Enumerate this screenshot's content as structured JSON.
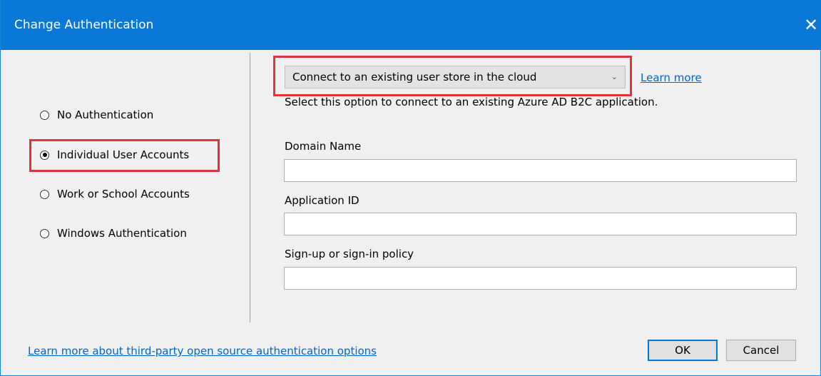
{
  "window": {
    "title": "Change Authentication",
    "close_glyph": "✕"
  },
  "auth_options": {
    "items": [
      {
        "label": "No Authentication",
        "selected": false
      },
      {
        "label": "Individual User Accounts",
        "selected": true
      },
      {
        "label": "Work or School Accounts",
        "selected": false
      },
      {
        "label": "Windows Authentication",
        "selected": false
      }
    ]
  },
  "store": {
    "selected": "Connect to an existing user store in the cloud",
    "chevron": "⌄",
    "learn_more": "Learn more",
    "description": "Select this option to connect to an existing Azure AD B2C application."
  },
  "fields": {
    "domain_label": "Domain Name",
    "domain_value": "",
    "app_id_label": "Application ID",
    "app_id_value": "",
    "policy_label": "Sign-up or sign-in policy",
    "policy_value": ""
  },
  "footer": {
    "third_party_link": "Learn more about third-party open source authentication options",
    "ok_label": "OK",
    "cancel_label": "Cancel"
  },
  "colors": {
    "titlebar": "#0a78d6",
    "highlight": "#e0343b",
    "link": "#0066cc"
  }
}
